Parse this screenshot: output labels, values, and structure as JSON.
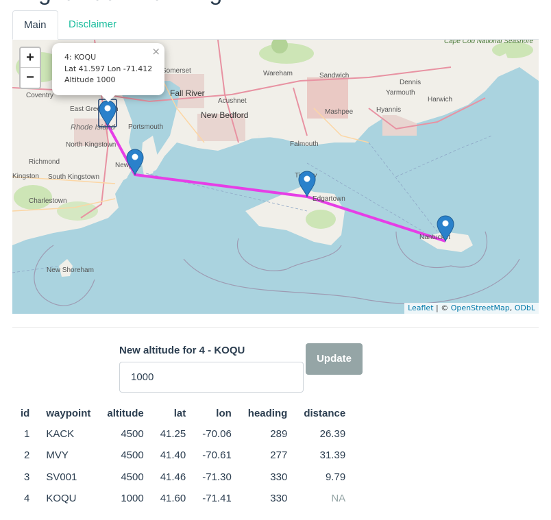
{
  "page": {
    "title": "Flight Path Planning"
  },
  "tabs": [
    {
      "label": "Main",
      "active": true
    },
    {
      "label": "Disclaimer",
      "active": false
    }
  ],
  "map": {
    "zoom_in": "+",
    "zoom_out": "−",
    "popup": {
      "line1": "4: KOQU",
      "line2": "Lat 41.597 Lon -71.412",
      "line3": "Altitude 1000",
      "close": "×"
    },
    "attribution": {
      "leaflet": "Leaflet",
      "sep": " | © ",
      "osm": "OpenStreetMap",
      "comma": ", ",
      "odbl": "ODbL"
    },
    "route_color": "#e63ee6",
    "marker_color": "#2a81cb",
    "place_labels": [
      "Somerset",
      "Wareham",
      "Sandwich",
      "Dennis",
      "Yarmouth",
      "Harwich",
      "Cape Cod National Seashore",
      "Fall River",
      "Acushnet",
      "New Bedford",
      "Mashpee",
      "Hyannis",
      "East Greenwich",
      "Rhode Island",
      "Portsmouth",
      "Falmouth",
      "North Kingstown",
      "Newport",
      "Richmond",
      "South Kingstown",
      "Tisbury",
      "Edgartown",
      "Charlestown",
      "Nantucket",
      "New Shoreham",
      "Coventry",
      "Kingston"
    ]
  },
  "form": {
    "label": "New altitude for 4 - KOQU",
    "value": "1000",
    "button": "Update"
  },
  "table": {
    "headers": [
      "id",
      "waypoint",
      "altitude",
      "lat",
      "lon",
      "heading",
      "distance"
    ],
    "rows": [
      {
        "id": "1",
        "waypoint": "KACK",
        "altitude": "4500",
        "lat": "41.25",
        "lon": "-70.06",
        "heading": "289",
        "distance": "26.39"
      },
      {
        "id": "2",
        "waypoint": "MVY",
        "altitude": "4500",
        "lat": "41.40",
        "lon": "-70.61",
        "heading": "277",
        "distance": "31.39"
      },
      {
        "id": "3",
        "waypoint": "SV001",
        "altitude": "4500",
        "lat": "41.46",
        "lon": "-71.30",
        "heading": "330",
        "distance": "9.79"
      },
      {
        "id": "4",
        "waypoint": "KOQU",
        "altitude": "1000",
        "lat": "41.60",
        "lon": "-71.41",
        "heading": "330",
        "distance": "NA"
      }
    ]
  }
}
